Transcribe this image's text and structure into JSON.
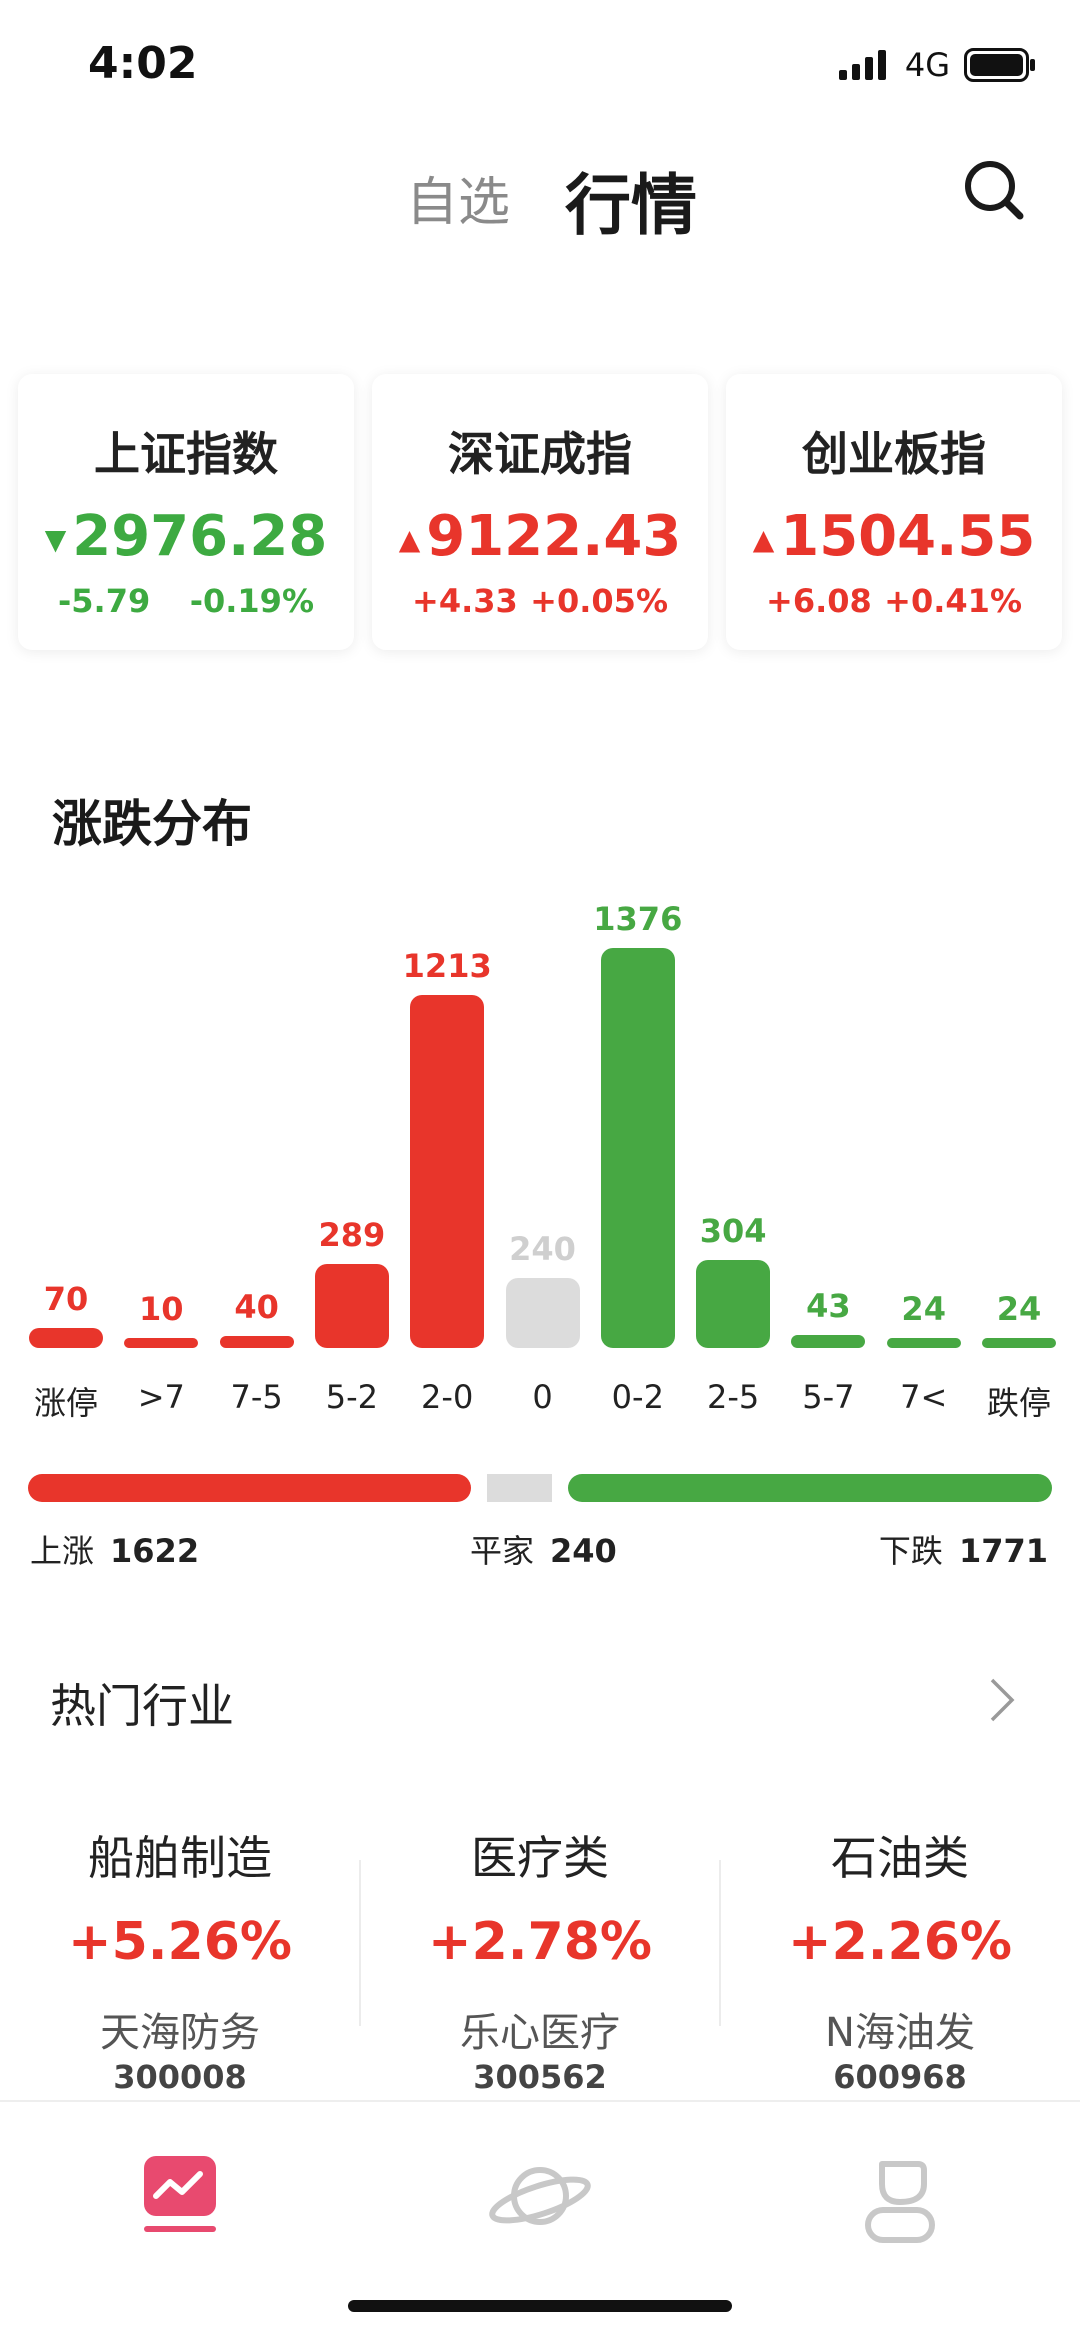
{
  "status_bar": {
    "time": "4:02",
    "network": "4G"
  },
  "header": {
    "tab_watchlist": "自选",
    "tab_market": "行情",
    "search_icon": "search-icon"
  },
  "indices": [
    {
      "name": "上证指数",
      "value": "2976.28",
      "change": "-5.79",
      "percent": "-0.19%",
      "direction": "down",
      "arrow": "▼",
      "color": "#3daa41"
    },
    {
      "name": "深证成指",
      "value": "9122.43",
      "change": "+4.33",
      "percent": "+0.05%",
      "direction": "up",
      "arrow": "▲",
      "color": "#e8352b"
    },
    {
      "name": "创业板指",
      "value": "1504.55",
      "change": "+6.08",
      "percent": "+0.41%",
      "direction": "up",
      "arrow": "▲",
      "color": "#e8352b"
    }
  ],
  "distribution": {
    "title": "涨跌分布",
    "colors": {
      "up": "#e8352b",
      "flat": "#dcdcdc",
      "down": "#47a843",
      "flat_label": "#cfcfcf"
    },
    "summary": {
      "up_label": "上涨",
      "up_count": "1622",
      "flat_label": "平家",
      "flat_count": "240",
      "down_label": "下跌",
      "down_count": "1771"
    }
  },
  "chart_data": {
    "type": "bar",
    "categories": [
      "涨停",
      ">7",
      "7-5",
      "5-2",
      "2-0",
      "0",
      "0-2",
      "2-5",
      "5-7",
      "7<",
      "跌停"
    ],
    "values": [
      70,
      10,
      40,
      289,
      1213,
      240,
      1376,
      304,
      43,
      24,
      24
    ],
    "value_labels": [
      "70",
      "10",
      "40",
      "289",
      "1213",
      "240",
      "1376",
      "304",
      "43",
      "24",
      "24"
    ],
    "bar_groups": [
      "up",
      "up",
      "up",
      "up",
      "up",
      "flat",
      "down",
      "down",
      "down",
      "down",
      "down"
    ],
    "title": "涨跌分布",
    "xlabel": "",
    "ylabel": "",
    "grid": false
  },
  "hot_industry": {
    "title": "热门行业",
    "items": [
      {
        "name": "船舶制造",
        "percent": "+5.26%",
        "stock": "天海防务",
        "code": "300008"
      },
      {
        "name": "医疗类",
        "percent": "+2.78%",
        "stock": "乐心医疗",
        "code": "300562"
      },
      {
        "name": "石油类",
        "percent": "+2.26%",
        "stock": "N海油发",
        "code": "600968"
      }
    ],
    "percent_color": "#e8352b"
  },
  "bottom_nav": [
    {
      "icon": "market-chart-icon",
      "active": true,
      "color": "#e84a6f"
    },
    {
      "icon": "planet-icon",
      "active": false,
      "color": "#c8c8c8"
    },
    {
      "icon": "profile-icon",
      "active": false,
      "color": "#c8c8c8"
    }
  ]
}
